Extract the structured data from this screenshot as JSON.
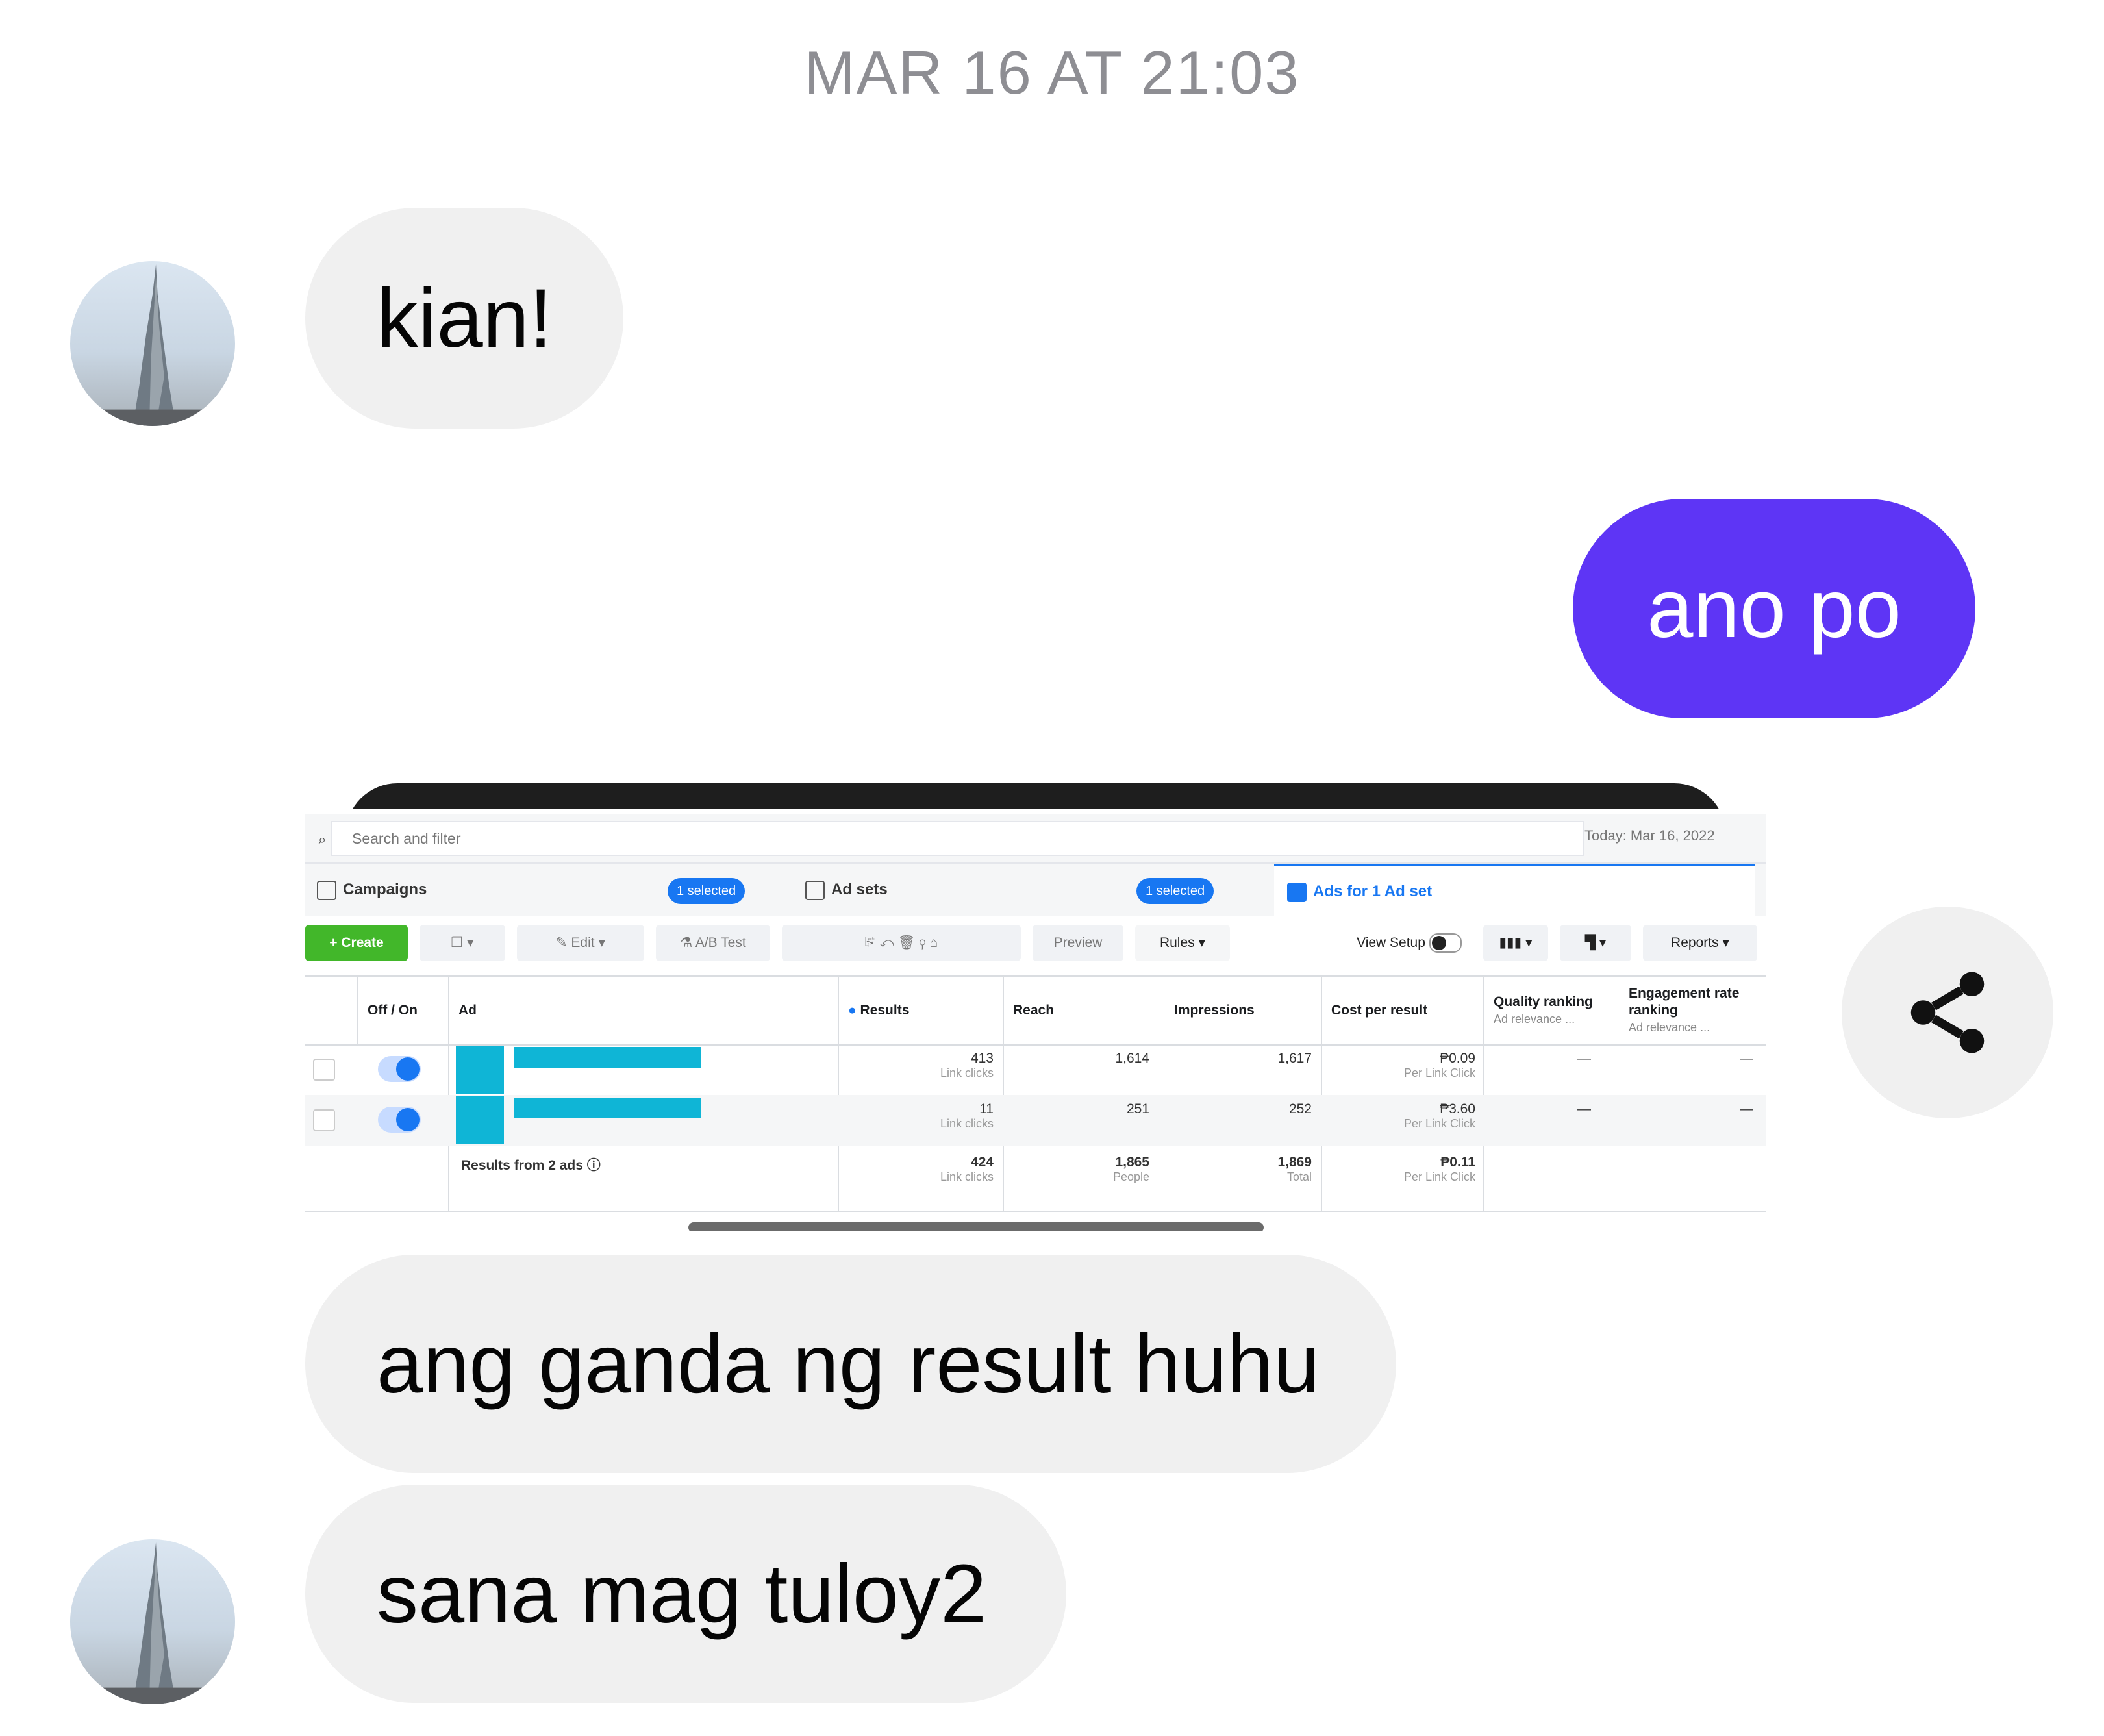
{
  "conversation": {
    "timestamp": "MAR 16 AT 21:03",
    "messages": {
      "m1": "kian!",
      "m2": "ano po",
      "m3": "ang ganda ng result huhu",
      "m4": "sana mag tuloy2"
    }
  },
  "colors": {
    "outgoing_bubble": "#5e35f5",
    "incoming_bubble": "#f0f0f0",
    "ads_blue": "#1877f2",
    "create_green": "#42b72a",
    "redacted_cyan": "#0fb5d6"
  },
  "shared_screenshot": {
    "search_placeholder": "Search and filter",
    "date": "Today: Mar 16, 2022",
    "tabs": {
      "campaigns": "Campaigns",
      "campaigns_selected": "1 selected",
      "adsets": "Ad sets",
      "adsets_selected": "1 selected",
      "ads": "Ads for 1 Ad set"
    },
    "toolbar": {
      "create": "+ Create",
      "edit": "Edit",
      "ab_test": "A/B Test",
      "preview": "Preview",
      "rules": "Rules",
      "view_setup": "View Setup",
      "reports": "Reports"
    },
    "columns": {
      "off_on": "Off / On",
      "ad": "Ad",
      "results": "Results",
      "reach": "Reach",
      "impressions": "Impressions",
      "cost_per_result": "Cost per result",
      "quality": "Quality ranking",
      "quality_sub": "Ad relevance ...",
      "engagement": "Engagement rate ranking",
      "engagement_sub": "Ad relevance ..."
    },
    "rows": [
      {
        "results": "413",
        "results_sub": "Link clicks",
        "reach": "1,614",
        "impressions": "1,617",
        "cost": "₱0.09",
        "cost_sub": "Per Link Click",
        "quality": "—",
        "engagement": "—"
      },
      {
        "results": "11",
        "results_sub": "Link clicks",
        "reach": "251",
        "impressions": "252",
        "cost": "₱3.60",
        "cost_sub": "Per Link Click",
        "quality": "—",
        "engagement": "—"
      }
    ],
    "totals": {
      "label": "Results from 2 ads",
      "results": "424",
      "results_sub": "Link clicks",
      "reach": "1,865",
      "reach_sub": "People",
      "impressions": "1,869",
      "impressions_sub": "Total",
      "cost": "₱0.11",
      "cost_sub": "Per Link Click"
    }
  }
}
